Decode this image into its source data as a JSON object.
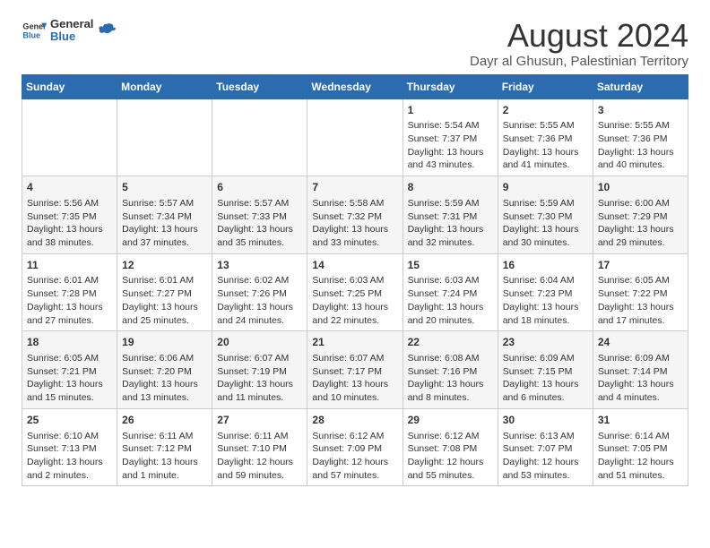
{
  "header": {
    "logo_general": "General",
    "logo_blue": "Blue",
    "title": "August 2024",
    "subtitle": "Dayr al Ghusun, Palestinian Territory"
  },
  "calendar": {
    "days_of_week": [
      "Sunday",
      "Monday",
      "Tuesday",
      "Wednesday",
      "Thursday",
      "Friday",
      "Saturday"
    ],
    "weeks": [
      [
        {
          "day": "",
          "content": ""
        },
        {
          "day": "",
          "content": ""
        },
        {
          "day": "",
          "content": ""
        },
        {
          "day": "",
          "content": ""
        },
        {
          "day": "1",
          "content": "Sunrise: 5:54 AM\nSunset: 7:37 PM\nDaylight: 13 hours and 43 minutes."
        },
        {
          "day": "2",
          "content": "Sunrise: 5:55 AM\nSunset: 7:36 PM\nDaylight: 13 hours and 41 minutes."
        },
        {
          "day": "3",
          "content": "Sunrise: 5:55 AM\nSunset: 7:36 PM\nDaylight: 13 hours and 40 minutes."
        }
      ],
      [
        {
          "day": "4",
          "content": "Sunrise: 5:56 AM\nSunset: 7:35 PM\nDaylight: 13 hours and 38 minutes."
        },
        {
          "day": "5",
          "content": "Sunrise: 5:57 AM\nSunset: 7:34 PM\nDaylight: 13 hours and 37 minutes."
        },
        {
          "day": "6",
          "content": "Sunrise: 5:57 AM\nSunset: 7:33 PM\nDaylight: 13 hours and 35 minutes."
        },
        {
          "day": "7",
          "content": "Sunrise: 5:58 AM\nSunset: 7:32 PM\nDaylight: 13 hours and 33 minutes."
        },
        {
          "day": "8",
          "content": "Sunrise: 5:59 AM\nSunset: 7:31 PM\nDaylight: 13 hours and 32 minutes."
        },
        {
          "day": "9",
          "content": "Sunrise: 5:59 AM\nSunset: 7:30 PM\nDaylight: 13 hours and 30 minutes."
        },
        {
          "day": "10",
          "content": "Sunrise: 6:00 AM\nSunset: 7:29 PM\nDaylight: 13 hours and 29 minutes."
        }
      ],
      [
        {
          "day": "11",
          "content": "Sunrise: 6:01 AM\nSunset: 7:28 PM\nDaylight: 13 hours and 27 minutes."
        },
        {
          "day": "12",
          "content": "Sunrise: 6:01 AM\nSunset: 7:27 PM\nDaylight: 13 hours and 25 minutes."
        },
        {
          "day": "13",
          "content": "Sunrise: 6:02 AM\nSunset: 7:26 PM\nDaylight: 13 hours and 24 minutes."
        },
        {
          "day": "14",
          "content": "Sunrise: 6:03 AM\nSunset: 7:25 PM\nDaylight: 13 hours and 22 minutes."
        },
        {
          "day": "15",
          "content": "Sunrise: 6:03 AM\nSunset: 7:24 PM\nDaylight: 13 hours and 20 minutes."
        },
        {
          "day": "16",
          "content": "Sunrise: 6:04 AM\nSunset: 7:23 PM\nDaylight: 13 hours and 18 minutes."
        },
        {
          "day": "17",
          "content": "Sunrise: 6:05 AM\nSunset: 7:22 PM\nDaylight: 13 hours and 17 minutes."
        }
      ],
      [
        {
          "day": "18",
          "content": "Sunrise: 6:05 AM\nSunset: 7:21 PM\nDaylight: 13 hours and 15 minutes."
        },
        {
          "day": "19",
          "content": "Sunrise: 6:06 AM\nSunset: 7:20 PM\nDaylight: 13 hours and 13 minutes."
        },
        {
          "day": "20",
          "content": "Sunrise: 6:07 AM\nSunset: 7:19 PM\nDaylight: 13 hours and 11 minutes."
        },
        {
          "day": "21",
          "content": "Sunrise: 6:07 AM\nSunset: 7:17 PM\nDaylight: 13 hours and 10 minutes."
        },
        {
          "day": "22",
          "content": "Sunrise: 6:08 AM\nSunset: 7:16 PM\nDaylight: 13 hours and 8 minutes."
        },
        {
          "day": "23",
          "content": "Sunrise: 6:09 AM\nSunset: 7:15 PM\nDaylight: 13 hours and 6 minutes."
        },
        {
          "day": "24",
          "content": "Sunrise: 6:09 AM\nSunset: 7:14 PM\nDaylight: 13 hours and 4 minutes."
        }
      ],
      [
        {
          "day": "25",
          "content": "Sunrise: 6:10 AM\nSunset: 7:13 PM\nDaylight: 13 hours and 2 minutes."
        },
        {
          "day": "26",
          "content": "Sunrise: 6:11 AM\nSunset: 7:12 PM\nDaylight: 13 hours and 1 minute."
        },
        {
          "day": "27",
          "content": "Sunrise: 6:11 AM\nSunset: 7:10 PM\nDaylight: 12 hours and 59 minutes."
        },
        {
          "day": "28",
          "content": "Sunrise: 6:12 AM\nSunset: 7:09 PM\nDaylight: 12 hours and 57 minutes."
        },
        {
          "day": "29",
          "content": "Sunrise: 6:12 AM\nSunset: 7:08 PM\nDaylight: 12 hours and 55 minutes."
        },
        {
          "day": "30",
          "content": "Sunrise: 6:13 AM\nSunset: 7:07 PM\nDaylight: 12 hours and 53 minutes."
        },
        {
          "day": "31",
          "content": "Sunrise: 6:14 AM\nSunset: 7:05 PM\nDaylight: 12 hours and 51 minutes."
        }
      ]
    ]
  }
}
